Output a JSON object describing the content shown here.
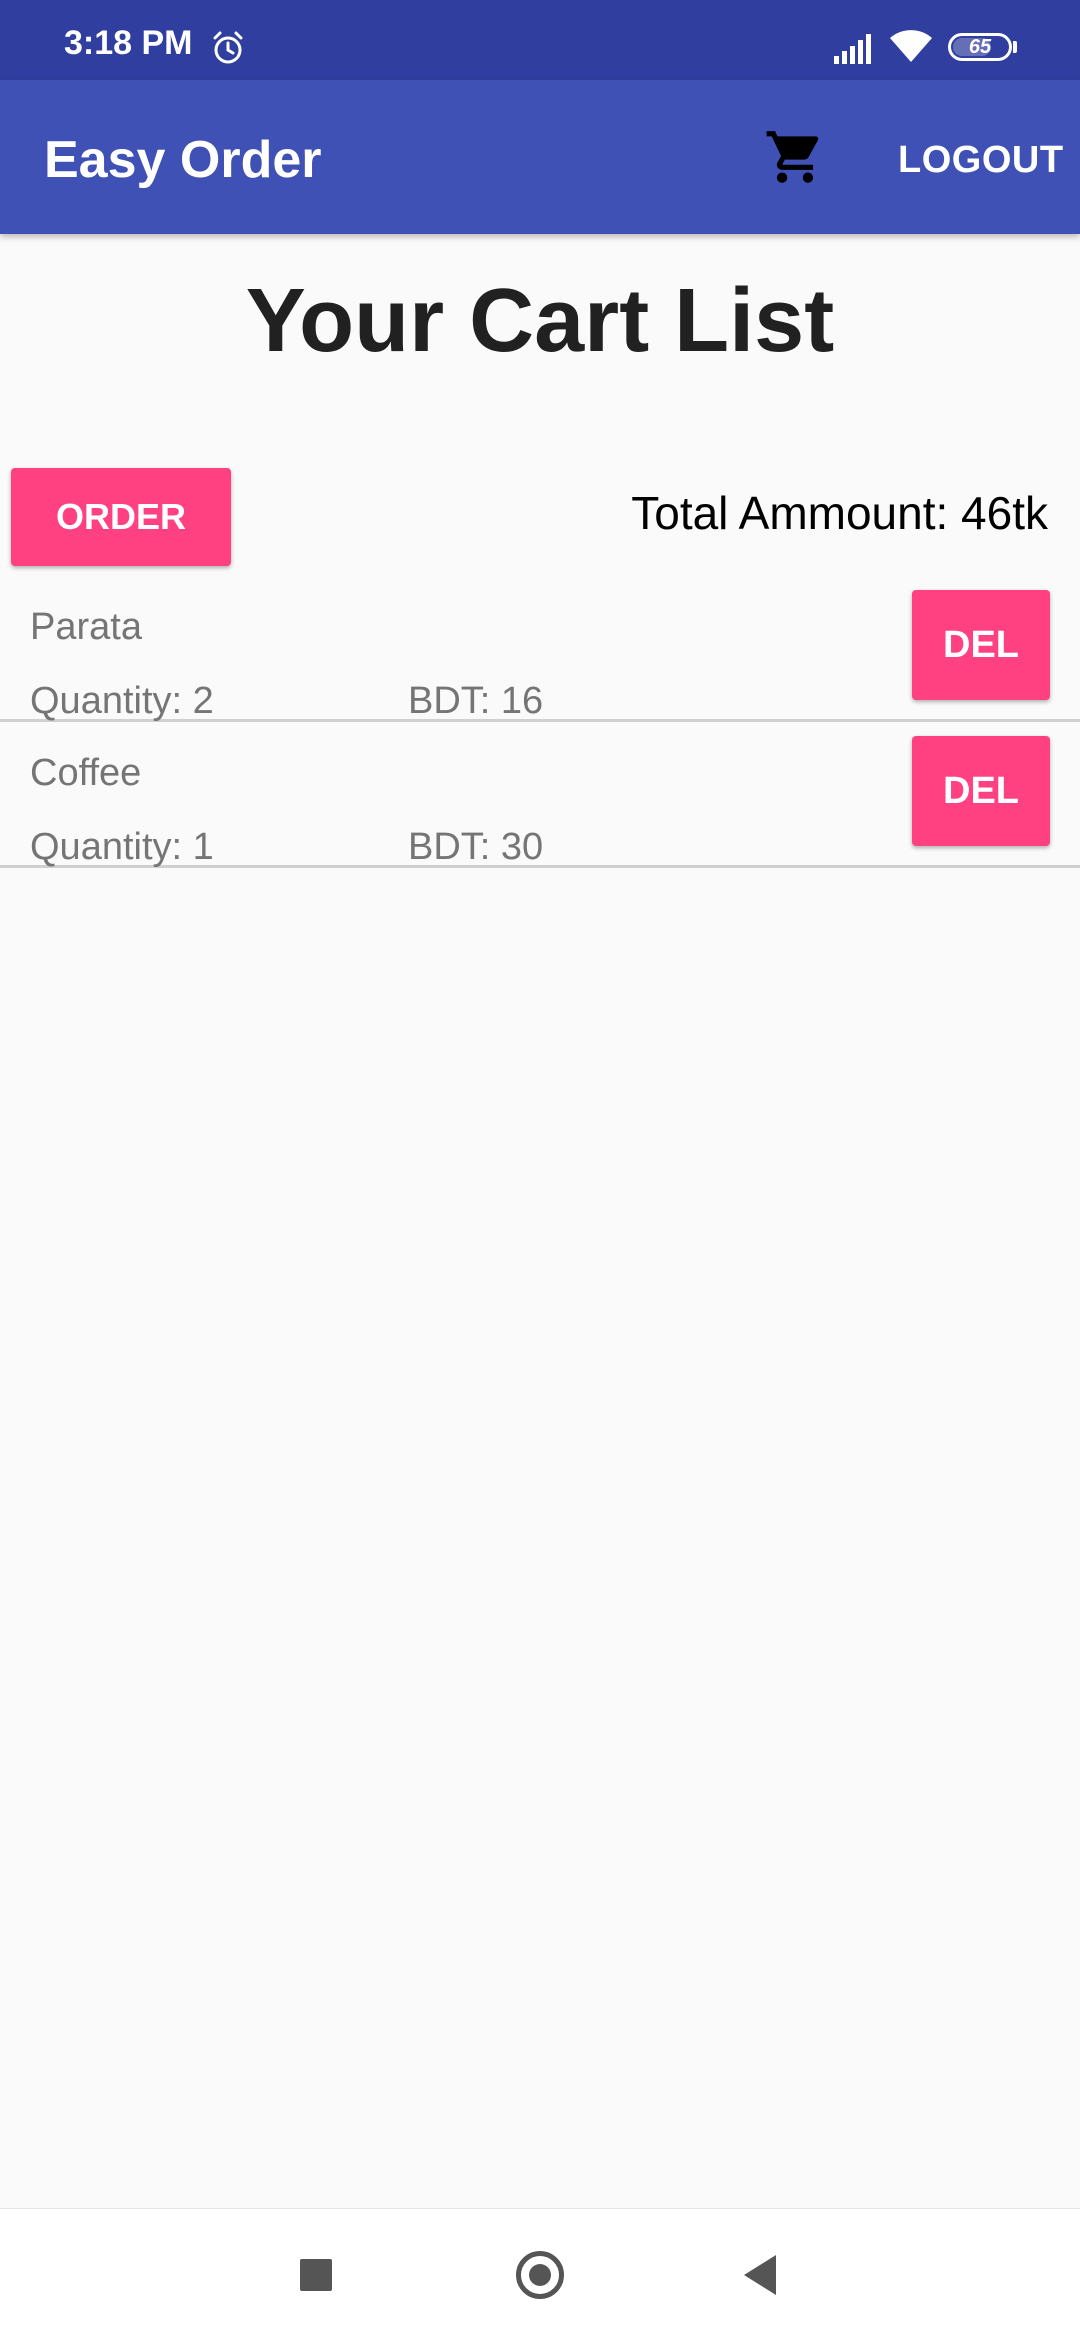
{
  "status_bar": {
    "time": "3:18 PM",
    "battery": "65",
    "icons": [
      "alarm-icon",
      "signal-icon",
      "wifi-icon",
      "battery-icon"
    ]
  },
  "app_bar": {
    "title": "Easy Order",
    "cart_icon": "cart-icon",
    "logout_label": "LOGOUT"
  },
  "page": {
    "title": "Your Cart List",
    "order_label": "ORDER",
    "total": "Total Ammount: 46tk"
  },
  "cart_items": [
    {
      "name": "Parata",
      "quantity": "Quantity: 2",
      "price": "BDT: 16",
      "delete_label": "DEL"
    },
    {
      "name": "Coffee",
      "quantity": "Quantity: 1",
      "price": "BDT: 30",
      "delete_label": "DEL"
    }
  ],
  "nav_bar": {
    "icons": [
      "recents-icon",
      "home-icon",
      "back-icon"
    ]
  },
  "colors": {
    "status_bar": "#303f9f",
    "primary": "#3f51b5",
    "accent": "#ff4081",
    "background": "#fafafa"
  }
}
